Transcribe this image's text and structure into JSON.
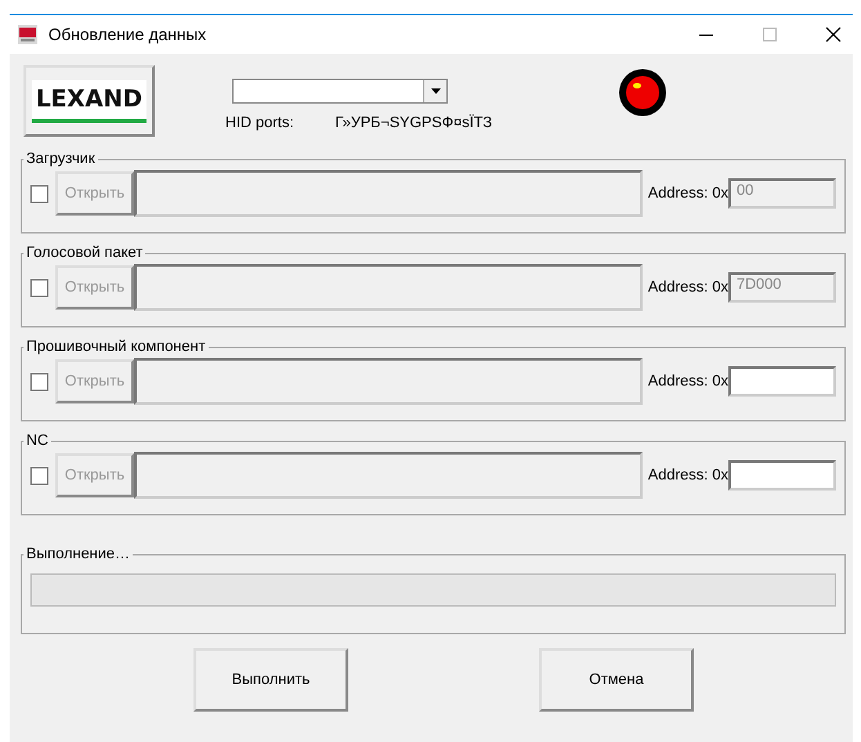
{
  "window": {
    "title": "Обновление данных"
  },
  "logo": "LEXAND",
  "port": {
    "label": "HID ports:",
    "device": "Г»УРБ¬SYGPSФ¤sЇТЗ"
  },
  "sections": [
    {
      "title": "Загрузчик",
      "checked": false,
      "open_button": "Открыть",
      "open_disabled": true,
      "address_label": "Address: 0x",
      "address": "00",
      "address_disabled": true
    },
    {
      "title": "Голосовой пакет",
      "checked": false,
      "open_button": "Открыть",
      "open_disabled": true,
      "address_label": "Address: 0x",
      "address": "7D000",
      "address_disabled": true
    },
    {
      "title": "Прошивочный компонент",
      "checked": false,
      "open_button": "Открыть",
      "open_disabled": true,
      "address_label": "Address: 0x",
      "address_disabled": false
    },
    {
      "title": "NC",
      "checked": false,
      "open_button": "Открыть",
      "open_disabled": true,
      "address_label": "Address: 0x",
      "address_disabled": false
    }
  ],
  "progress": {
    "title": "Выполнение…",
    "level": 0
  },
  "buttons": [
    "Выполнить",
    "Отмена"
  ]
}
